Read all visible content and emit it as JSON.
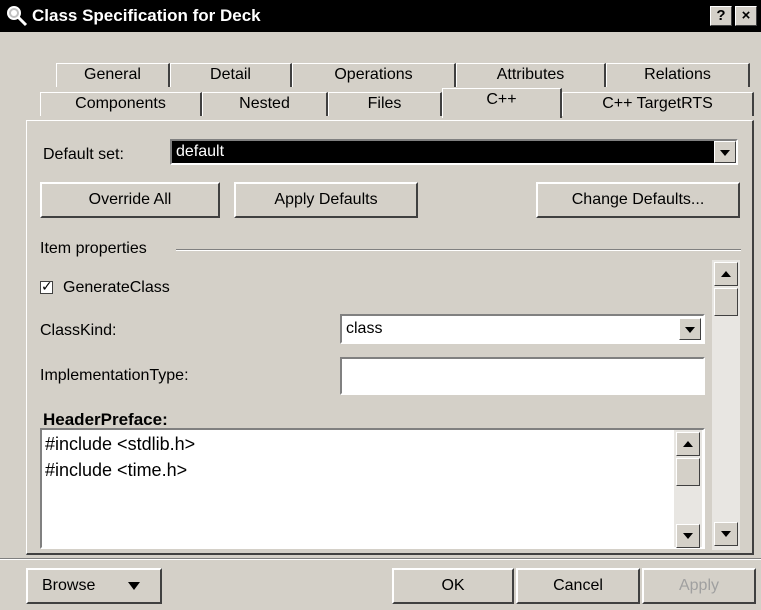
{
  "window": {
    "title": "Class Specification for Deck",
    "help_label": "?",
    "close_label": "×"
  },
  "tabs_row1": [
    "General",
    "Detail",
    "Operations",
    "Attributes",
    "Relations"
  ],
  "tabs_row2": [
    "Components",
    "Nested",
    "Files",
    "C++",
    "C++ TargetRTS"
  ],
  "active_tab": "C++",
  "default_set": {
    "label": "Default set:",
    "value": "default"
  },
  "buttons": {
    "override_all": "Override All",
    "apply_defaults": "Apply Defaults",
    "change_defaults": "Change Defaults..."
  },
  "item_properties": {
    "group_label": "Item properties",
    "generate_class": {
      "label": "GenerateClass",
      "checked": true
    },
    "class_kind": {
      "label": "ClassKind:",
      "value": "class"
    },
    "implementation_type": {
      "label": "ImplementationType:",
      "value": ""
    },
    "header_preface": {
      "label": "HeaderPreface:",
      "lines": [
        "#include <stdlib.h>",
        "#include <time.h>"
      ]
    }
  },
  "footer": {
    "browse": "Browse",
    "ok": "OK",
    "cancel": "Cancel",
    "apply": "Apply"
  },
  "colors": {
    "face": "#d4d0c8",
    "title_bar": "#000000",
    "selection": "#000000",
    "disabled_text": "#a0a0a0"
  }
}
